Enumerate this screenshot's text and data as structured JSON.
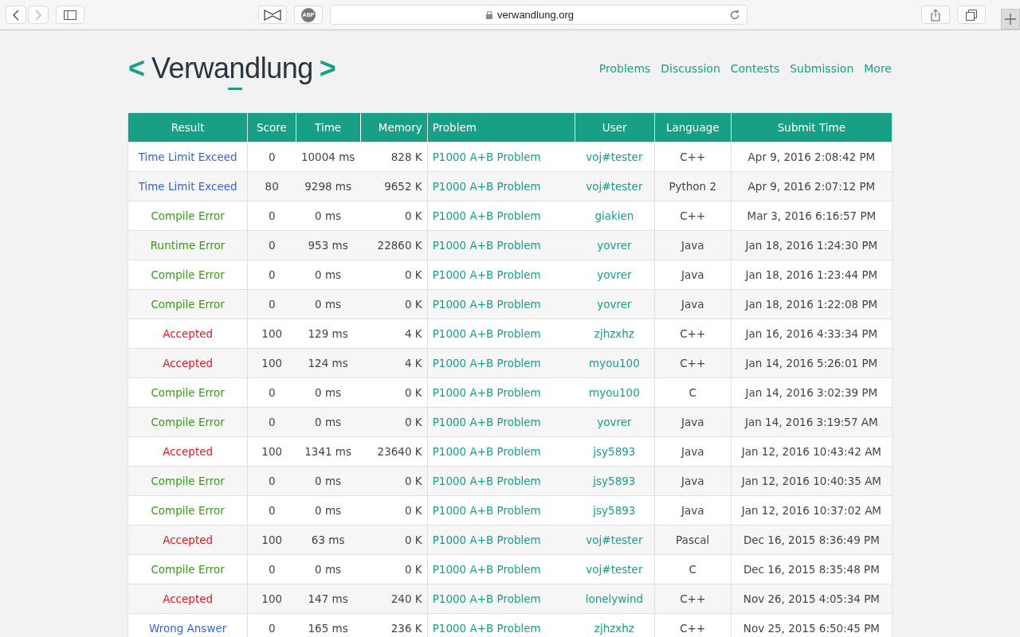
{
  "browser": {
    "url": "verwandlung.org",
    "adblock_label": "ABP"
  },
  "logo": {
    "left": "<",
    "name": "Verwandlung",
    "right": ">"
  },
  "nav": [
    "Problems",
    "Discussion",
    "Contests",
    "Submission",
    "More"
  ],
  "table": {
    "columns": [
      "Result",
      "Score",
      "Time",
      "Memory",
      "Problem",
      "User",
      "Language",
      "Submit Time"
    ],
    "rows": [
      {
        "kind": "tle",
        "result": "Time Limit Exceed",
        "score": "0",
        "time": "10004 ms",
        "memory": "828 K",
        "problem": "P1000 A+B Problem",
        "user": "voj#tester",
        "language": "C++",
        "submit_time": "Apr 9, 2016 2:08:42 PM"
      },
      {
        "kind": "tle",
        "result": "Time Limit Exceed",
        "score": "80",
        "time": "9298 ms",
        "memory": "9652 K",
        "problem": "P1000 A+B Problem",
        "user": "voj#tester",
        "language": "Python 2",
        "submit_time": "Apr 9, 2016 2:07:12 PM"
      },
      {
        "kind": "ce",
        "result": "Compile Error",
        "score": "0",
        "time": "0 ms",
        "memory": "0 K",
        "problem": "P1000 A+B Problem",
        "user": "giakien",
        "language": "C++",
        "submit_time": "Mar 3, 2016 6:16:57 PM"
      },
      {
        "kind": "re",
        "result": "Runtime Error",
        "score": "0",
        "time": "953 ms",
        "memory": "22860 K",
        "problem": "P1000 A+B Problem",
        "user": "yovrer",
        "language": "Java",
        "submit_time": "Jan 18, 2016 1:24:30 PM"
      },
      {
        "kind": "ce",
        "result": "Compile Error",
        "score": "0",
        "time": "0 ms",
        "memory": "0 K",
        "problem": "P1000 A+B Problem",
        "user": "yovrer",
        "language": "Java",
        "submit_time": "Jan 18, 2016 1:23:44 PM"
      },
      {
        "kind": "ce",
        "result": "Compile Error",
        "score": "0",
        "time": "0 ms",
        "memory": "0 K",
        "problem": "P1000 A+B Problem",
        "user": "yovrer",
        "language": "Java",
        "submit_time": "Jan 18, 2016 1:22:08 PM"
      },
      {
        "kind": "ac",
        "result": "Accepted",
        "score": "100",
        "time": "129 ms",
        "memory": "4 K",
        "problem": "P1000 A+B Problem",
        "user": "zjhzxhz",
        "language": "C++",
        "submit_time": "Jan 16, 2016 4:33:34 PM"
      },
      {
        "kind": "ac",
        "result": "Accepted",
        "score": "100",
        "time": "124 ms",
        "memory": "4 K",
        "problem": "P1000 A+B Problem",
        "user": "myou100",
        "language": "C++",
        "submit_time": "Jan 14, 2016 5:26:01 PM"
      },
      {
        "kind": "ce",
        "result": "Compile Error",
        "score": "0",
        "time": "0 ms",
        "memory": "0 K",
        "problem": "P1000 A+B Problem",
        "user": "myou100",
        "language": "C",
        "submit_time": "Jan 14, 2016 3:02:39 PM"
      },
      {
        "kind": "ce",
        "result": "Compile Error",
        "score": "0",
        "time": "0 ms",
        "memory": "0 K",
        "problem": "P1000 A+B Problem",
        "user": "yovrer",
        "language": "Java",
        "submit_time": "Jan 14, 2016 3:19:57 AM"
      },
      {
        "kind": "ac",
        "result": "Accepted",
        "score": "100",
        "time": "1341 ms",
        "memory": "23640 K",
        "problem": "P1000 A+B Problem",
        "user": "jsy5893",
        "language": "Java",
        "submit_time": "Jan 12, 2016 10:43:42 AM"
      },
      {
        "kind": "ce",
        "result": "Compile Error",
        "score": "0",
        "time": "0 ms",
        "memory": "0 K",
        "problem": "P1000 A+B Problem",
        "user": "jsy5893",
        "language": "Java",
        "submit_time": "Jan 12, 2016 10:40:35 AM"
      },
      {
        "kind": "ce",
        "result": "Compile Error",
        "score": "0",
        "time": "0 ms",
        "memory": "0 K",
        "problem": "P1000 A+B Problem",
        "user": "jsy5893",
        "language": "Java",
        "submit_time": "Jan 12, 2016 10:37:02 AM"
      },
      {
        "kind": "ac",
        "result": "Accepted",
        "score": "100",
        "time": "63 ms",
        "memory": "0 K",
        "problem": "P1000 A+B Problem",
        "user": "voj#tester",
        "language": "Pascal",
        "submit_time": "Dec 16, 2015 8:36:49 PM"
      },
      {
        "kind": "ce",
        "result": "Compile Error",
        "score": "0",
        "time": "0 ms",
        "memory": "0 K",
        "problem": "P1000 A+B Problem",
        "user": "voj#tester",
        "language": "C",
        "submit_time": "Dec 16, 2015 8:35:48 PM"
      },
      {
        "kind": "ac",
        "result": "Accepted",
        "score": "100",
        "time": "147 ms",
        "memory": "240 K",
        "problem": "P1000 A+B Problem",
        "user": "lonelywind",
        "language": "C++",
        "submit_time": "Nov 26, 2015 4:05:34 PM"
      },
      {
        "kind": "wa",
        "result": "Wrong Answer",
        "score": "0",
        "time": "165 ms",
        "memory": "236 K",
        "problem": "P1000 A+B Problem",
        "user": "zjhzxhz",
        "language": "C++",
        "submit_time": "Nov 25, 2015 6:50:45 PM"
      }
    ]
  }
}
